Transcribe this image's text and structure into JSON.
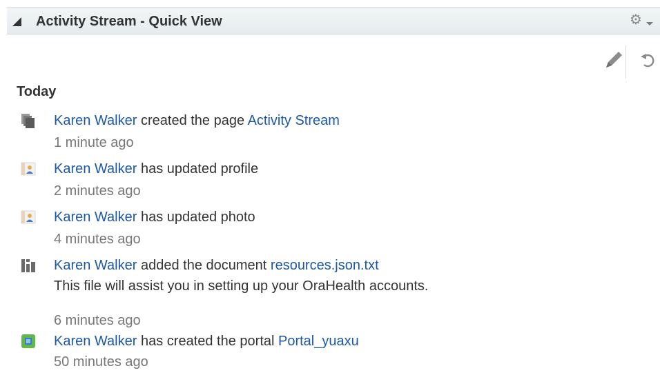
{
  "header": {
    "title": "Activity Stream - Quick View",
    "collapse_icon": "collapse-triangle-icon",
    "menu_icon": "gear-icon"
  },
  "toolbar": {
    "edit_icon": "pencil-icon",
    "refresh_icon": "refresh-icon"
  },
  "section": {
    "heading": "Today"
  },
  "activities": [
    {
      "icon": "pages-icon",
      "actor": "Karen Walker",
      "action": " created the page ",
      "object": "Activity Stream",
      "time": "1 minute ago"
    },
    {
      "icon": "profile-icon",
      "actor": "Karen Walker",
      "action": " has updated profile",
      "time": "2 minutes ago"
    },
    {
      "icon": "profile-icon",
      "actor": "Karen Walker",
      "action": " has updated photo",
      "time": "4 minutes ago"
    },
    {
      "icon": "document-library-icon",
      "actor": "Karen Walker",
      "action": " added the document ",
      "object": "resources.json.txt",
      "description": "This file will assist you in setting up your OraHealth accounts.",
      "time": "6 minutes ago"
    },
    {
      "icon": "portal-icon",
      "actor": "Karen Walker",
      "action": " has created the portal ",
      "object": "Portal_yuaxu",
      "time": "50 minutes ago"
    }
  ],
  "colors": {
    "link": "#1c58a8",
    "text": "#333333",
    "muted": "#777777",
    "header_bg": "#e6ecee",
    "portal_green": "#5fb84a"
  }
}
